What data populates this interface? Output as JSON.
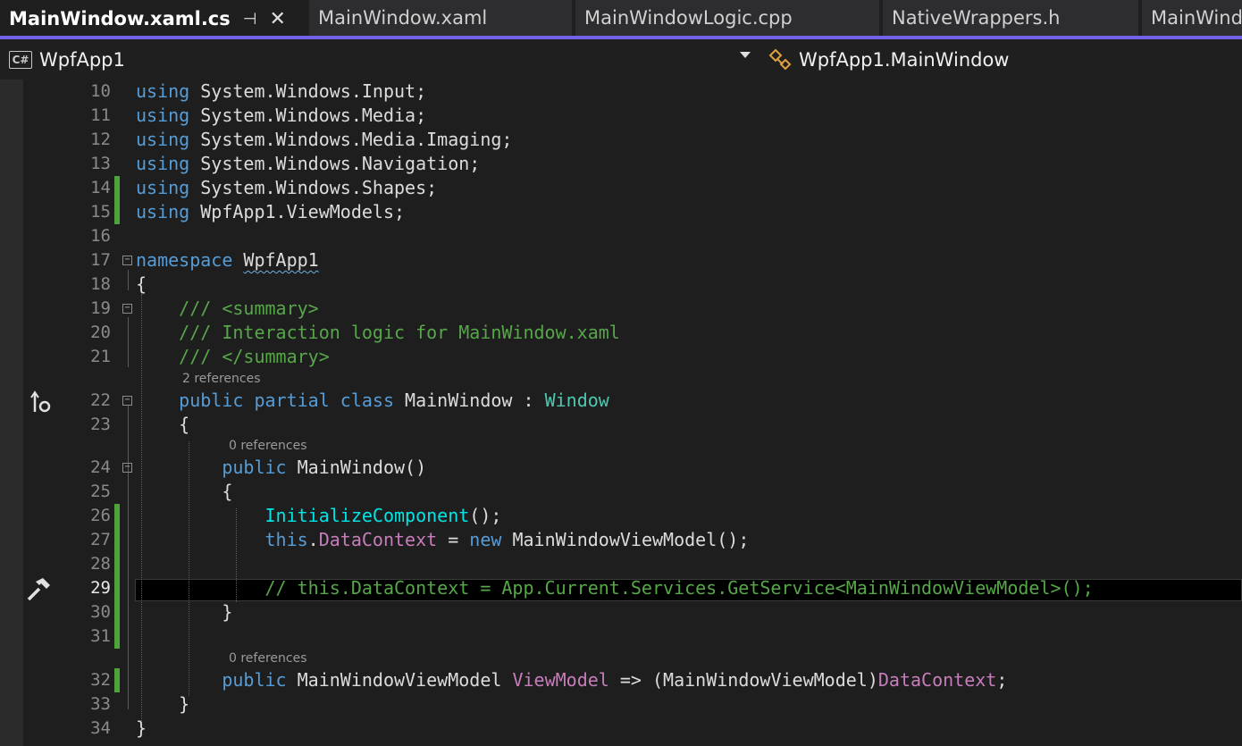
{
  "tabs": [
    {
      "label": "MainWindow.xaml.cs",
      "active": true
    },
    {
      "label": "MainWindow.xaml",
      "active": false
    },
    {
      "label": "MainWindowLogic.cpp",
      "active": false
    },
    {
      "label": "NativeWrappers.h",
      "active": false
    },
    {
      "label": "MainWind",
      "active": false
    }
  ],
  "tab_icons": {
    "pin": "pin-icon",
    "close": "close-icon"
  },
  "navbar": {
    "project_badge": "C#",
    "project": "WpfApp1",
    "type": "WpfApp1.MainWindow"
  },
  "lens": {
    "class_refs": "2 references",
    "ctor_refs": "0 references",
    "prop_refs": "0 references"
  },
  "lines": [
    {
      "n": "10",
      "parts": [
        [
          "kw",
          "using"
        ],
        [
          "ns",
          " System.Windows.Input;"
        ]
      ]
    },
    {
      "n": "11",
      "parts": [
        [
          "kw",
          "using"
        ],
        [
          "ns",
          " System.Windows.Media;"
        ]
      ]
    },
    {
      "n": "12",
      "parts": [
        [
          "kw",
          "using"
        ],
        [
          "ns",
          " System.Windows.Media.Imaging;"
        ]
      ]
    },
    {
      "n": "13",
      "parts": [
        [
          "kw",
          "using"
        ],
        [
          "ns",
          " System.Windows.Navigation;"
        ]
      ]
    },
    {
      "n": "14",
      "parts": [
        [
          "kw",
          "using"
        ],
        [
          "ns",
          " System.Windows.Shapes;"
        ]
      ]
    },
    {
      "n": "15",
      "parts": [
        [
          "kw",
          "using"
        ],
        [
          "ns",
          " WpfApp1.ViewModels;"
        ]
      ]
    },
    {
      "n": "16",
      "parts": []
    },
    {
      "n": "17",
      "parts": [
        [
          "kw",
          "namespace"
        ],
        [
          "id",
          " "
        ],
        [
          "squig",
          "WpfApp1"
        ]
      ]
    },
    {
      "n": "18",
      "parts": [
        [
          "id",
          "{"
        ]
      ]
    },
    {
      "n": "19",
      "parts": [
        [
          "cm",
          "    /// <summary>"
        ]
      ]
    },
    {
      "n": "20",
      "parts": [
        [
          "cm",
          "    /// Interaction logic for MainWindow.xaml"
        ]
      ]
    },
    {
      "n": "21",
      "parts": [
        [
          "cm",
          "    /// </summary>"
        ]
      ]
    },
    {
      "n": "22",
      "parts": [
        [
          "id",
          "    "
        ],
        [
          "kw",
          "public partial class"
        ],
        [
          "id",
          " MainWindow : "
        ],
        [
          "ty",
          "Window"
        ]
      ]
    },
    {
      "n": "23",
      "parts": [
        [
          "id",
          "    {"
        ]
      ]
    },
    {
      "n": "24",
      "parts": [
        [
          "id",
          "        "
        ],
        [
          "kw",
          "public"
        ],
        [
          "id",
          " MainWindow()"
        ]
      ]
    },
    {
      "n": "25",
      "parts": [
        [
          "id",
          "        {"
        ]
      ]
    },
    {
      "n": "26",
      "parts": [
        [
          "id",
          "            "
        ],
        [
          "mth",
          "InitializeComponent"
        ],
        [
          "id",
          "();"
        ]
      ]
    },
    {
      "n": "27",
      "parts": [
        [
          "id",
          "            "
        ],
        [
          "kw",
          "this"
        ],
        [
          "id",
          "."
        ],
        [
          "pr",
          "DataContext"
        ],
        [
          "id",
          " = "
        ],
        [
          "kw",
          "new"
        ],
        [
          "id",
          " MainWindowViewModel();"
        ]
      ]
    },
    {
      "n": "28",
      "parts": []
    },
    {
      "n": "29",
      "parts": [
        [
          "cm",
          "            // this.DataContext = App.Current.Services.GetService<MainWindowViewModel>();"
        ]
      ]
    },
    {
      "n": "30",
      "parts": [
        [
          "id",
          "        }"
        ]
      ]
    },
    {
      "n": "31",
      "parts": []
    },
    {
      "n": "32",
      "parts": [
        [
          "id",
          "        "
        ],
        [
          "kw",
          "public"
        ],
        [
          "id",
          " MainWindowViewModel "
        ],
        [
          "pr",
          "ViewModel"
        ],
        [
          "id",
          " => (MainWindowViewModel)"
        ],
        [
          "pr",
          "DataContext"
        ],
        [
          "id",
          ";"
        ]
      ]
    },
    {
      "n": "33",
      "parts": [
        [
          "id",
          "    }"
        ]
      ]
    },
    {
      "n": "34",
      "parts": [
        [
          "id",
          "}"
        ]
      ]
    }
  ],
  "margin_icons": {
    "line22": "implementation-arrow-icon",
    "line29": "hammer-icon"
  }
}
